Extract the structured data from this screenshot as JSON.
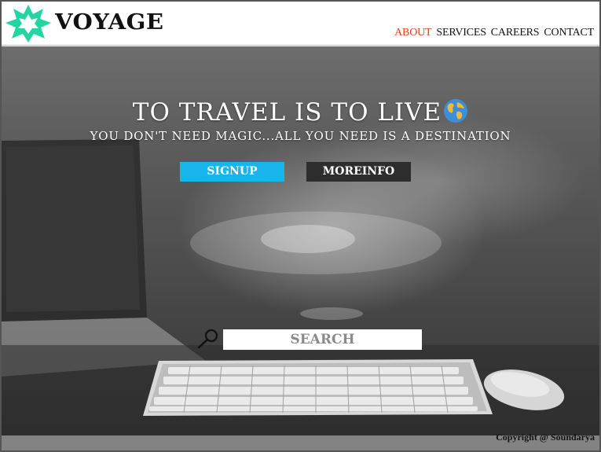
{
  "brand": {
    "name": "VOYAGE",
    "logo_icon": "star-burst-icon",
    "logo_color": "#22d6a3"
  },
  "nav": {
    "items": [
      {
        "label": "ABOUT",
        "active": true
      },
      {
        "label": "SERVICES",
        "active": false
      },
      {
        "label": "CAREERS",
        "active": false
      },
      {
        "label": "CONTACT",
        "active": false
      }
    ],
    "active_color": "#e8401c"
  },
  "hero": {
    "title": "TO TRAVEL IS TO LIVE",
    "title_icon": "globe-icon",
    "subtitle": "YOU DON'T NEED MAGIC...ALL YOU NEED IS A DESTINATION",
    "background": "desk-laptop-keyboard-photo"
  },
  "buttons": {
    "signup_label": "SIGNUP",
    "signup_color": "#18b4ec",
    "moreinfo_label": "MOREINFO",
    "moreinfo_color": "#2d2d2d"
  },
  "search": {
    "placeholder": "SEARCH",
    "icon": "magnifier-icon"
  },
  "footer": {
    "copyright": "Copyright @ Soundarya"
  }
}
